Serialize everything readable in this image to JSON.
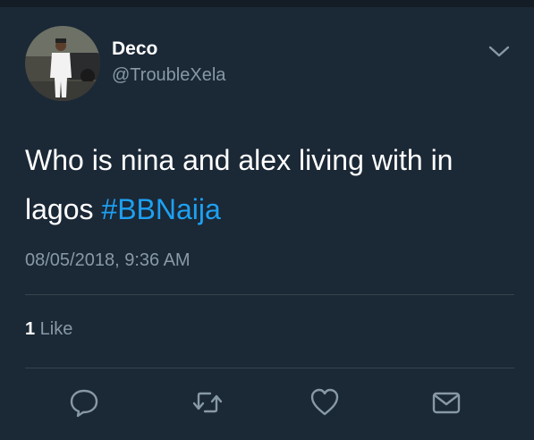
{
  "author": {
    "display_name": "Deco",
    "handle": "@TroubleXela",
    "avatar_icon": "profile-photo"
  },
  "tweet": {
    "text": "Who is nina and alex living with in lagos ",
    "hashtag": "#BBNaija",
    "timestamp": "08/05/2018, 9:36 AM"
  },
  "engagement": {
    "like_count": "1",
    "like_label": " Like"
  },
  "actions": [
    {
      "icon": "reply-icon"
    },
    {
      "icon": "retweet-icon"
    },
    {
      "icon": "like-icon"
    },
    {
      "icon": "share-icon"
    }
  ],
  "colors": {
    "background": "#1b2836",
    "text": "#ffffff",
    "secondary": "#8899a6",
    "link": "#1da1f2",
    "divider": "#38444d"
  }
}
